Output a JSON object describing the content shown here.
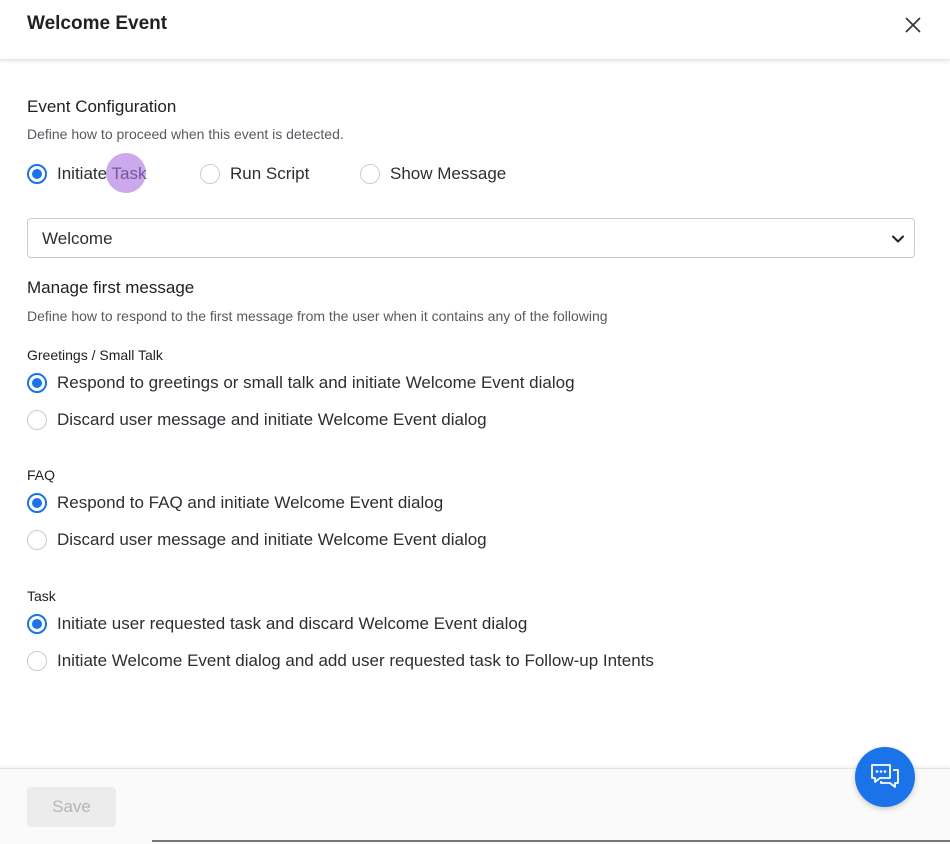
{
  "header": {
    "title": "Welcome Event"
  },
  "event_config": {
    "title": "Event Configuration",
    "subtitle": "Define how to proceed when this event is detected.",
    "options": [
      {
        "label": "Initiate Task",
        "selected": true
      },
      {
        "label": "Run Script",
        "selected": false
      },
      {
        "label": "Show Message",
        "selected": false
      }
    ],
    "task_select": {
      "value": "Welcome"
    }
  },
  "first_message": {
    "title": "Manage first message",
    "subtitle": "Define how to respond to the first message from the user when it contains any of the following",
    "groups": [
      {
        "label": "Greetings / Small Talk",
        "options": [
          {
            "label": "Respond to greetings or small talk and initiate Welcome Event dialog",
            "selected": true
          },
          {
            "label": "Discard user message and initiate Welcome Event dialog",
            "selected": false
          }
        ]
      },
      {
        "label": "FAQ",
        "options": [
          {
            "label": "Respond to FAQ and initiate Welcome Event dialog",
            "selected": true
          },
          {
            "label": "Discard user message and initiate Welcome Event dialog",
            "selected": false
          }
        ]
      },
      {
        "label": "Task",
        "options": [
          {
            "label": "Initiate user requested task and discard Welcome Event dialog",
            "selected": true
          },
          {
            "label": "Initiate Welcome Event dialog and add user requested task to Follow-up Intents",
            "selected": false
          }
        ]
      }
    ]
  },
  "footer": {
    "save_label": "Save",
    "save_disabled": true
  },
  "icons": {
    "close": "close-icon",
    "chevron": "chevron-down-icon",
    "chat": "chat-icon"
  },
  "colors": {
    "accent": "#1a73e8",
    "highlight": "#aa6ee1",
    "disabled_bg": "#ececec",
    "disabled_text": "#b5b5b5"
  }
}
